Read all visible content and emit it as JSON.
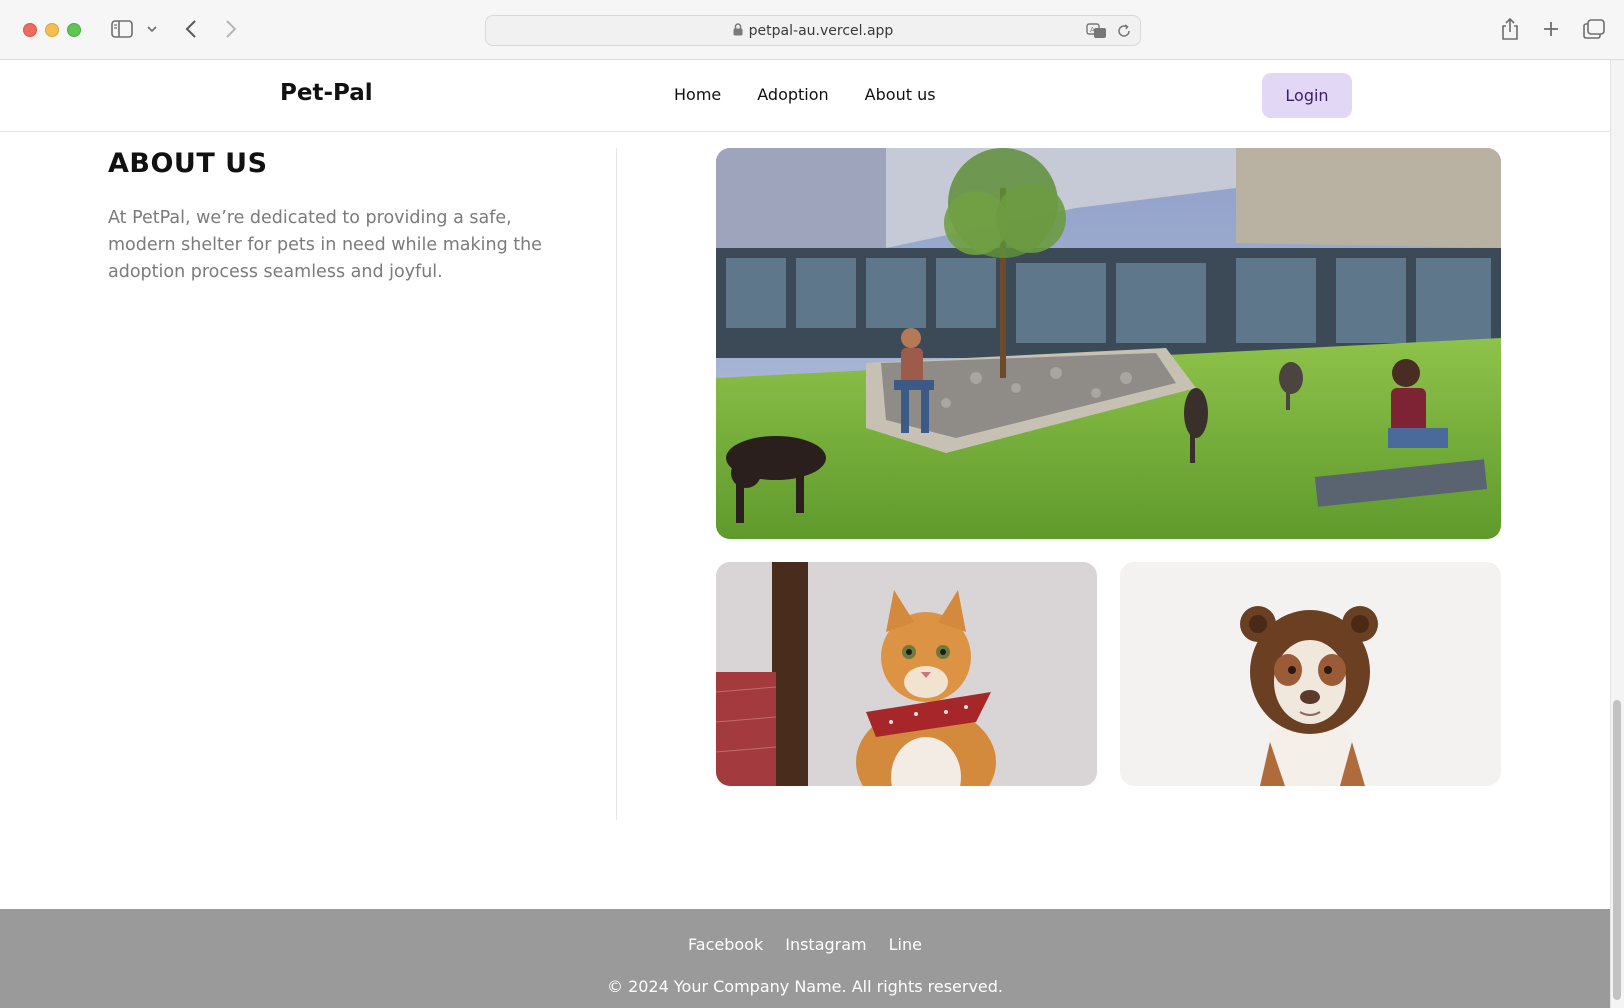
{
  "browser": {
    "url": "petpal-au.vercel.app",
    "icons": [
      "lock-icon",
      "translate-icon",
      "reload-icon",
      "sidebar-icon",
      "chevron-down-icon",
      "back-icon",
      "forward-icon",
      "share-icon",
      "plus-icon",
      "tabs-icon"
    ]
  },
  "header": {
    "brand": "Pet-Pal",
    "nav": [
      "Home",
      "Adoption",
      "About us"
    ],
    "login_label": "Login",
    "login_color": "#e3d7f6"
  },
  "about": {
    "title": "ABOUT US",
    "text": "At PetPal, we’re dedicated to providing a safe, modern shelter for pets in need while making the adoption process seamless and joyful."
  },
  "footer": {
    "links": [
      "Facebook",
      "Instagram",
      "Line"
    ],
    "copyright": "© 2024 Your Company Name. All rights reserved.",
    "background": "#9a9a9a"
  }
}
